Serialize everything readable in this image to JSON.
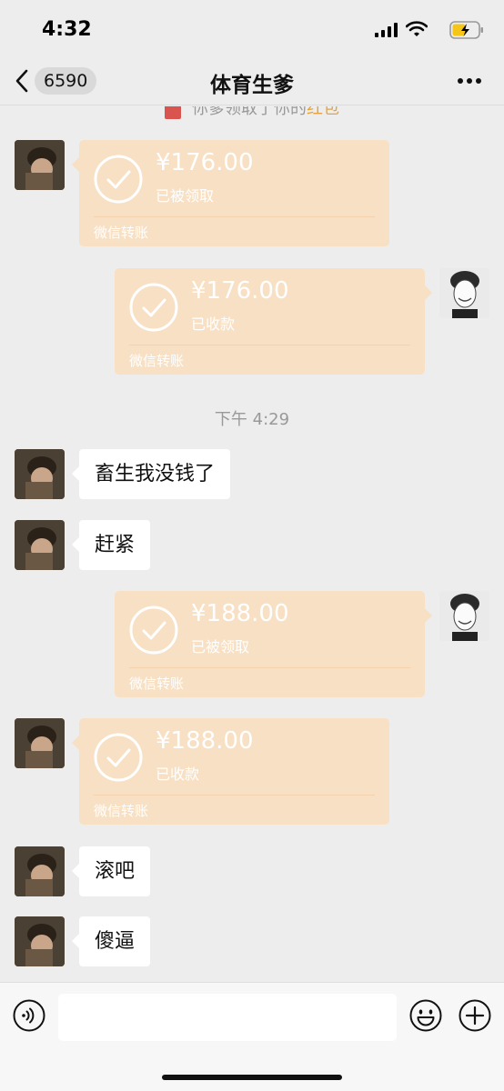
{
  "status_bar": {
    "time": "4:32"
  },
  "nav": {
    "unread_count": "6590",
    "title": "体育生爹"
  },
  "system_message": {
    "text": "你爹领取了你的",
    "highlight": "红包"
  },
  "messages": [
    {
      "type": "transfer",
      "side": "left",
      "amount": "¥176.00",
      "status": "已被领取",
      "footer": "微信转账"
    },
    {
      "type": "transfer",
      "side": "right",
      "amount": "¥176.00",
      "status": "已收款",
      "footer": "微信转账"
    },
    {
      "type": "time",
      "text": "下午 4:29"
    },
    {
      "type": "text",
      "side": "left",
      "text": "畜生我没钱了"
    },
    {
      "type": "text",
      "side": "left",
      "text": "赶紧"
    },
    {
      "type": "transfer",
      "side": "right",
      "amount": "¥188.00",
      "status": "已被领取",
      "footer": "微信转账"
    },
    {
      "type": "transfer",
      "side": "left",
      "amount": "¥188.00",
      "status": "已收款",
      "footer": "微信转账"
    },
    {
      "type": "text",
      "side": "left",
      "text": "滚吧"
    },
    {
      "type": "text",
      "side": "left",
      "text": "傻逼"
    }
  ],
  "input": {
    "value": "",
    "placeholder": ""
  },
  "colors": {
    "transfer_card": "#f8e0c4",
    "background": "#ededed",
    "bubble": "#ffffff"
  },
  "icons": [
    "back-icon",
    "more-icon",
    "check-icon",
    "voice-icon",
    "emoji-icon",
    "plus-icon"
  ]
}
